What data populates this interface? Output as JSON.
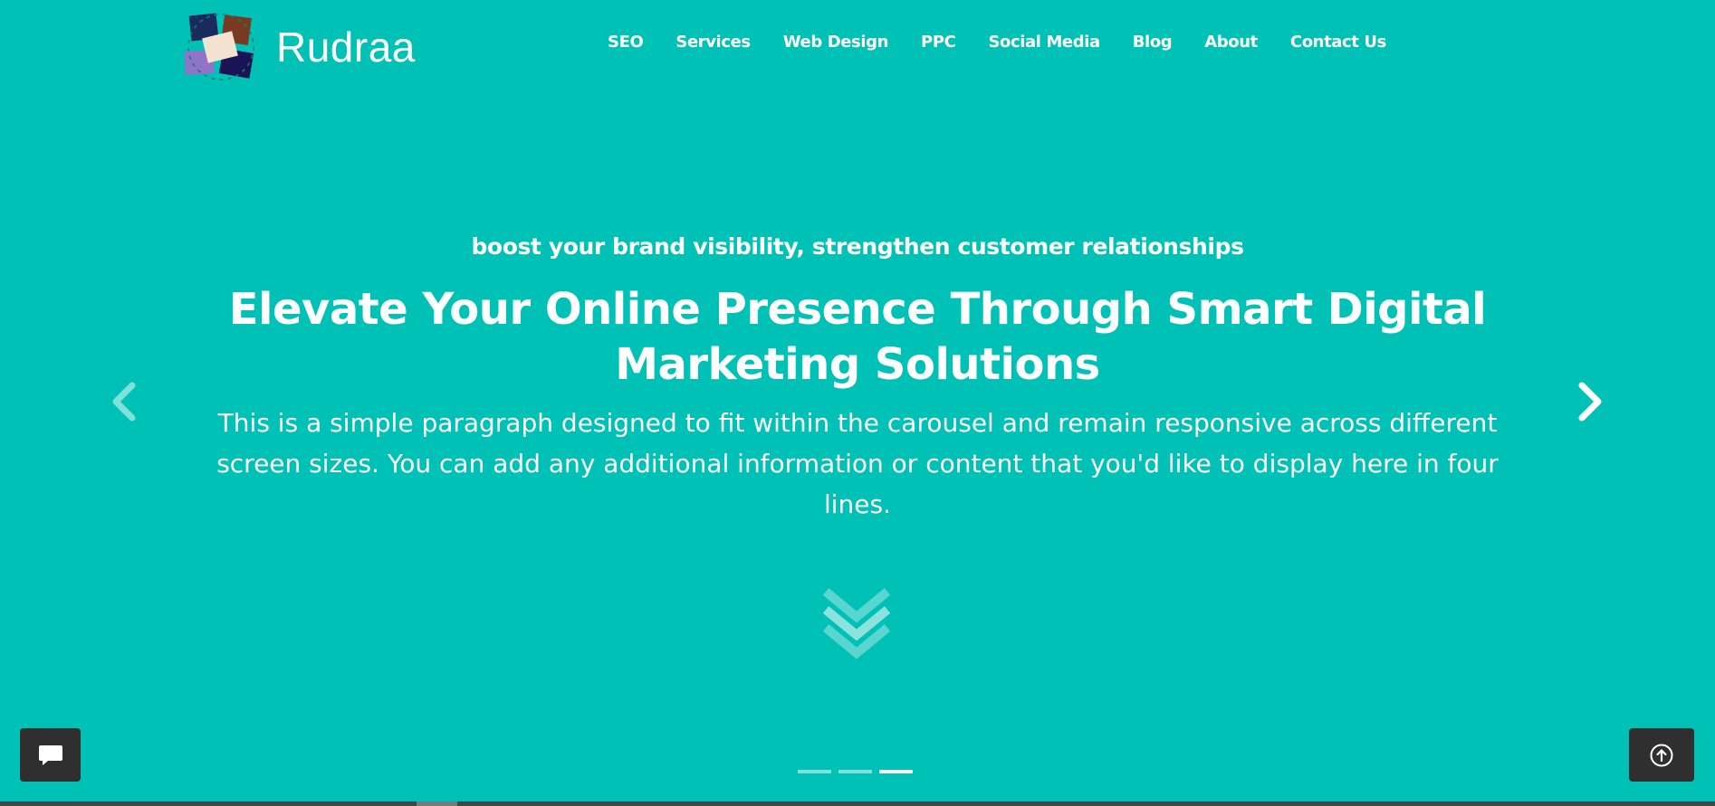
{
  "colors": {
    "background": "#00c1b5",
    "text": "#ffffff",
    "floating_button": "#2f2f2f"
  },
  "brand": {
    "name": "Rudraa",
    "logo_icon": "collage-logo-icon"
  },
  "nav": {
    "items": [
      {
        "label": "SEO"
      },
      {
        "label": "Services"
      },
      {
        "label": "Web Design"
      },
      {
        "label": "PPC"
      },
      {
        "label": "Social Media"
      },
      {
        "label": "Blog"
      },
      {
        "label": "About"
      },
      {
        "label": "Contact Us"
      }
    ]
  },
  "hero": {
    "eyebrow": "boost your brand visibility, strengthen customer relationships",
    "headline": "Elevate Your Online Presence Through Smart Digital Marketing Solutions",
    "description": "This is a simple paragraph designed to fit within the carousel and remain responsive across different screen sizes. You can add any additional information or content that you'd like to display here in four lines."
  },
  "carousel": {
    "prev_icon": "chevron-left-icon",
    "next_icon": "chevron-right-icon",
    "slide_count": 3,
    "active_slide": 3
  },
  "scroll_icon": "double-chevron-down-icon",
  "floating": {
    "chat_icon": "chat-bubble-icon",
    "top_icon": "arrow-up-circle-icon"
  }
}
